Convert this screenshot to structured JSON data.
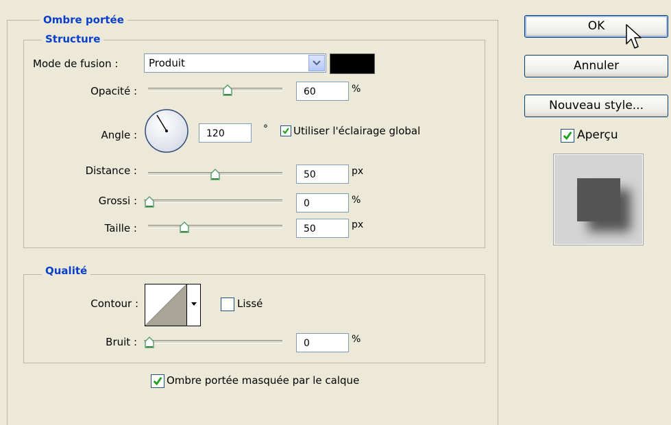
{
  "drop_shadow": {
    "title": "Ombre portée",
    "structure": {
      "title": "Structure",
      "blend_mode_label": "Mode de fusion :",
      "blend_mode_value": "Produit",
      "shadow_color": "#000000",
      "opacity_label": "Opacité :",
      "opacity_value": "60",
      "opacity_unit": "%",
      "opacity_slider": 0.6,
      "angle_label": "Angle :",
      "angle_value": "120",
      "angle_unit": "°",
      "global_light_label": "Utiliser l'éclairage global",
      "global_light_checked": true,
      "distance_label": "Distance :",
      "distance_value": "50",
      "distance_unit": "px",
      "distance_slider": 0.5,
      "spread_label": "Grossi :",
      "spread_value": "0",
      "spread_unit": "%",
      "spread_slider": 0.0,
      "size_label": "Taille :",
      "size_value": "50",
      "size_unit": "px",
      "size_slider": 0.25
    },
    "quality": {
      "title": "Qualité",
      "contour_label": "Contour :",
      "antialias_label": "Lissé",
      "antialias_checked": false,
      "noise_label": "Bruit :",
      "noise_value": "0",
      "noise_unit": "%",
      "noise_slider": 0.0
    },
    "knockout_label": "Ombre portée masquée par le calque",
    "knockout_checked": true
  },
  "buttons": {
    "ok": "OK",
    "cancel": "Annuler",
    "new_style": "Nouveau style..."
  },
  "preview": {
    "label": "Aperçu",
    "checked": true
  }
}
